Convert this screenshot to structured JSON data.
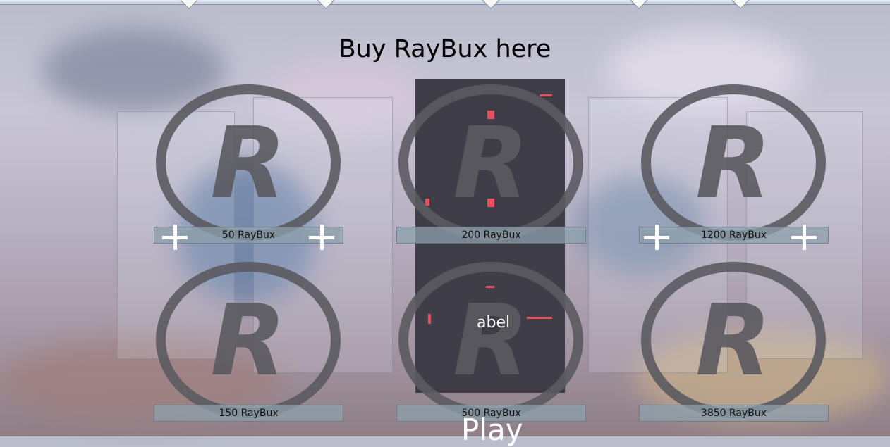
{
  "title": "Buy RayBux here",
  "coins": [
    {
      "label": "50 RayBux",
      "icon": "raybux-coin-icon"
    },
    {
      "label": "200 RayBux",
      "icon": "raybux-coin-icon"
    },
    {
      "label": "1200 RayBux",
      "icon": "raybux-coin-icon"
    },
    {
      "label": "150 RayBux",
      "icon": "raybux-coin-icon"
    },
    {
      "label": "500 RayBux",
      "icon": "raybux-coin-icon"
    },
    {
      "label": "3850 RayBux",
      "icon": "raybux-coin-icon"
    }
  ],
  "overlay_label": "abel",
  "play_label": "Play",
  "colors": {
    "coin": "#5b5a60",
    "dark_panel": "#3f3e48",
    "accent_red": "#e3525a",
    "label_bg": "#8ca0ac"
  }
}
